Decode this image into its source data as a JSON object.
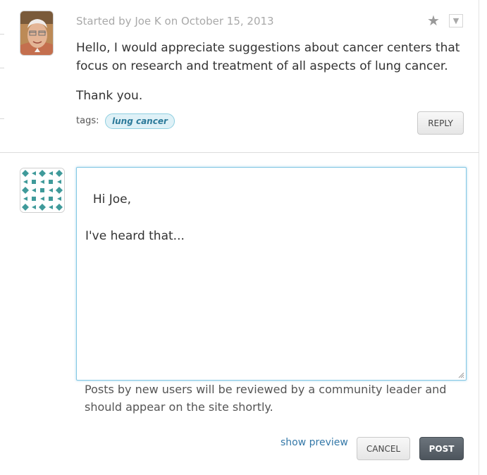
{
  "thread": {
    "meta": "Started by Joe K on October 15, 2013",
    "body": [
      "Hello, I would appreciate suggestions about cancer centers that focus on research and treatment of all aspects of lung cancer.",
      "Thank you."
    ],
    "tags_label": "tags:",
    "tags": [
      "lung cancer"
    ],
    "star_icon": "★",
    "menu_icon": "▼",
    "reply_label": "REPLY"
  },
  "composer": {
    "text": "Hi Joe,\n\nI've heard that...",
    "notice": "Posts by new users will be reviewed by a community leader and should appear on the site shortly.",
    "show_preview": "show preview",
    "cancel_label": "CANCEL",
    "post_label": "POST"
  },
  "colors": {
    "tag_background": "#dff1f7",
    "tag_text": "#2c7a9a",
    "identicon": "#3f9a9a",
    "focus_border": "#84c8e4",
    "post_button": "#555d65"
  }
}
